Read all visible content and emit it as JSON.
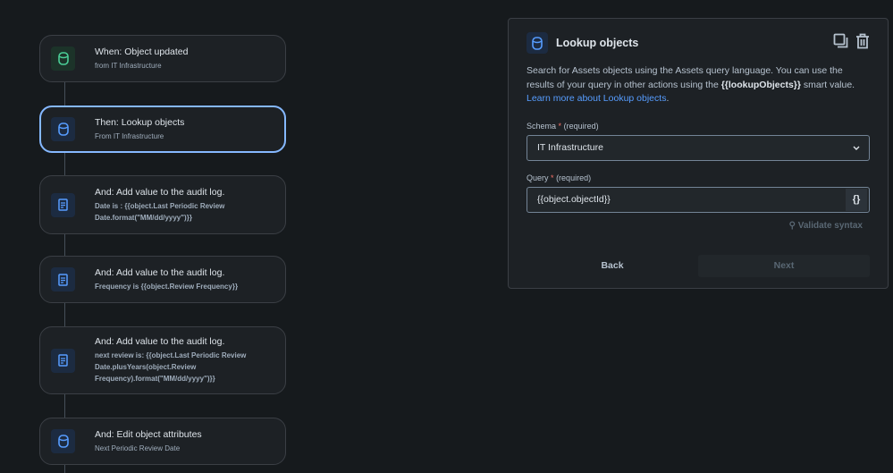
{
  "flow": [
    {
      "title": "When: Object updated",
      "sub": "from IT Infrastructure",
      "icon": "database-icon"
    },
    {
      "title": "Then: Lookup objects",
      "sub": "From IT Infrastructure",
      "icon": "database-icon"
    },
    {
      "title": "And: Add value to the audit log.",
      "sub": "Date is : {{object.Last Periodic Review Date.format(\"MM/dd/yyyy\")}}",
      "icon": "document-icon"
    },
    {
      "title": "And: Add value to the audit log.",
      "sub": "Frequency is {{object.Review Frequency}}",
      "icon": "document-icon"
    },
    {
      "title": "And: Add value to the audit log.",
      "sub": "next review is: {{object.Last Periodic Review Date.plusYears(object.Review Frequency).format(\"MM/dd/yyyy\")}}",
      "icon": "document-icon"
    },
    {
      "title": "And: Edit object attributes",
      "sub": "Next Periodic Review Date",
      "icon": "database-icon"
    }
  ],
  "panel": {
    "title": "Lookup objects",
    "desc1": "Search for Assets objects using the Assets query language. You can use the results of your query in other actions using the ",
    "smart": "{{lookupObjects}}",
    "desc2": " smart value.",
    "link": "Learn more about Lookup objects",
    "period": ".",
    "schema_label": "Schema",
    "required_mark": "*",
    "required": "(required)",
    "schema_value": "IT Infrastructure",
    "query_label": "Query",
    "query_value": "{{object.objectId}}",
    "braces": "{}",
    "validate": "Validate syntax",
    "back": "Back",
    "next": "Next"
  }
}
